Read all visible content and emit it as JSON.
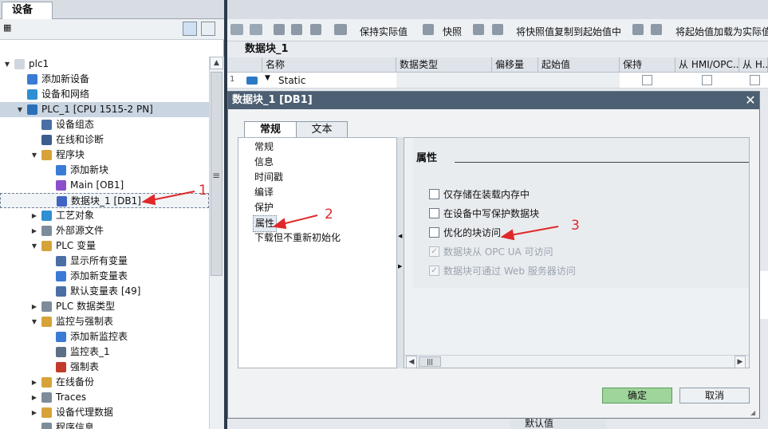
{
  "left_panel": {
    "tab": "设备",
    "tree": [
      {
        "label": "plc1",
        "level": 0,
        "expanded": true
      },
      {
        "label": "添加新设备",
        "level": 1
      },
      {
        "label": "设备和网络",
        "level": 1
      },
      {
        "label": "PLC_1 [CPU 1515-2 PN]",
        "level": 1,
        "expanded": true,
        "selected": true
      },
      {
        "label": "设备组态",
        "level": 2
      },
      {
        "label": "在线和诊断",
        "level": 2
      },
      {
        "label": "程序块",
        "level": 2,
        "expanded": true
      },
      {
        "label": "添加新块",
        "level": 3
      },
      {
        "label": "Main [OB1]",
        "level": 3
      },
      {
        "label": "数据块_1 [DB1]",
        "level": 3,
        "highlighted": true
      },
      {
        "label": "工艺对象",
        "level": 2,
        "collapsed": true
      },
      {
        "label": "外部源文件",
        "level": 2,
        "collapsed": true
      },
      {
        "label": "PLC 变量",
        "level": 2,
        "expanded": true
      },
      {
        "label": "显示所有变量",
        "level": 3
      },
      {
        "label": "添加新变量表",
        "level": 3
      },
      {
        "label": "默认变量表 [49]",
        "level": 3
      },
      {
        "label": "PLC 数据类型",
        "level": 2,
        "collapsed": true
      },
      {
        "label": "监控与强制表",
        "level": 2,
        "expanded": true
      },
      {
        "label": "添加新监控表",
        "level": 3
      },
      {
        "label": "监控表_1",
        "level": 3
      },
      {
        "label": "强制表",
        "level": 3
      },
      {
        "label": "在线备份",
        "level": 2,
        "collapsed": true
      },
      {
        "label": "Traces",
        "level": 2,
        "collapsed": true
      },
      {
        "label": "设备代理数据",
        "level": 2,
        "collapsed": true
      },
      {
        "label": "程序信息",
        "level": 2
      }
    ]
  },
  "editor": {
    "toolbar": {
      "keep_actual": "保持实际值",
      "snapshot": "快照",
      "copy_snapshot": "将快照值复制到起始值中",
      "load_start": "将起始值加载为实际值"
    },
    "block_title": "数据块_1",
    "columns": [
      "名称",
      "数据类型",
      "偏移量",
      "起始值",
      "保持",
      "从 HMI/OPC...",
      "从 H..."
    ],
    "row": {
      "index": "1",
      "name": "Static"
    },
    "footer_col": "默认值"
  },
  "dialog": {
    "title": "数据块_1 [DB1]",
    "tabs": [
      "常规",
      "文本"
    ],
    "nav_items": [
      "常规",
      "信息",
      "时间戳",
      "编译",
      "保护",
      "属性",
      "下载但不重新初始化"
    ],
    "section_title": "属性",
    "options": [
      {
        "label": "仅存储在装载内存中",
        "checked": false,
        "disabled": false
      },
      {
        "label": "在设备中写保护数据块",
        "checked": false,
        "disabled": false
      },
      {
        "label": "优化的块访问",
        "checked": false,
        "disabled": false
      },
      {
        "label": "数据块从 OPC UA 可访问",
        "checked": true,
        "disabled": true
      },
      {
        "label": "数据块可通过 Web 服务器访问",
        "checked": true,
        "disabled": true
      }
    ],
    "ok": "确定",
    "cancel": "取消"
  },
  "annotations": [
    "1",
    "2",
    "3"
  ],
  "colors": {
    "accent_red": "#e0282a",
    "ok_green": "#9fd59b",
    "title_bar": "#4d5f72"
  }
}
